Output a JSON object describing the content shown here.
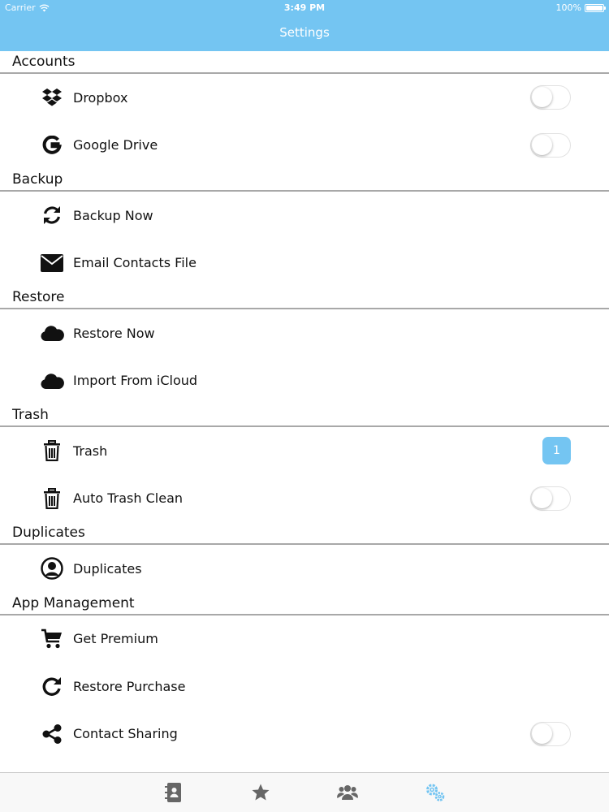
{
  "status_bar": {
    "carrier": "Carrier",
    "time": "3:49 PM",
    "battery": "100%"
  },
  "nav": {
    "title": "Settings"
  },
  "colors": {
    "accent": "#74c5f2",
    "divider": "#a8a8a8"
  },
  "sections": {
    "accounts": {
      "header": "Accounts",
      "dropbox": {
        "label": "Dropbox",
        "icon": "dropbox-icon",
        "toggle_on": false
      },
      "google_drive": {
        "label": "Google Drive",
        "icon": "google-icon",
        "toggle_on": false
      }
    },
    "backup": {
      "header": "Backup",
      "backup_now": {
        "label": "Backup Now",
        "icon": "sync-icon"
      },
      "email_contacts": {
        "label": "Email Contacts File",
        "icon": "envelope-icon"
      }
    },
    "restore": {
      "header": "Restore",
      "restore_now": {
        "label": "Restore Now",
        "icon": "cloud-icon"
      },
      "import_icloud": {
        "label": "Import From iCloud",
        "icon": "cloud-icon"
      }
    },
    "trash": {
      "header": "Trash",
      "trash": {
        "label": "Trash",
        "icon": "trash-icon",
        "badge": "1"
      },
      "auto_clean": {
        "label": "Auto Trash Clean",
        "icon": "trash-icon",
        "toggle_on": false
      }
    },
    "duplicates": {
      "header": "Duplicates",
      "duplicates": {
        "label": "Duplicates",
        "icon": "user-circle-icon"
      }
    },
    "app_management": {
      "header": "App Management",
      "get_premium": {
        "label": "Get Premium",
        "icon": "cart-icon"
      },
      "restore_purchase": {
        "label": "Restore Purchase",
        "icon": "redo-icon"
      },
      "contact_sharing": {
        "label": "Contact Sharing",
        "icon": "share-icon",
        "toggle_on": false
      }
    }
  },
  "tab_bar": {
    "tabs": [
      {
        "icon": "address-book-icon",
        "active": false
      },
      {
        "icon": "star-icon",
        "active": false
      },
      {
        "icon": "users-icon",
        "active": false
      },
      {
        "icon": "gears-icon",
        "active": true
      }
    ]
  }
}
